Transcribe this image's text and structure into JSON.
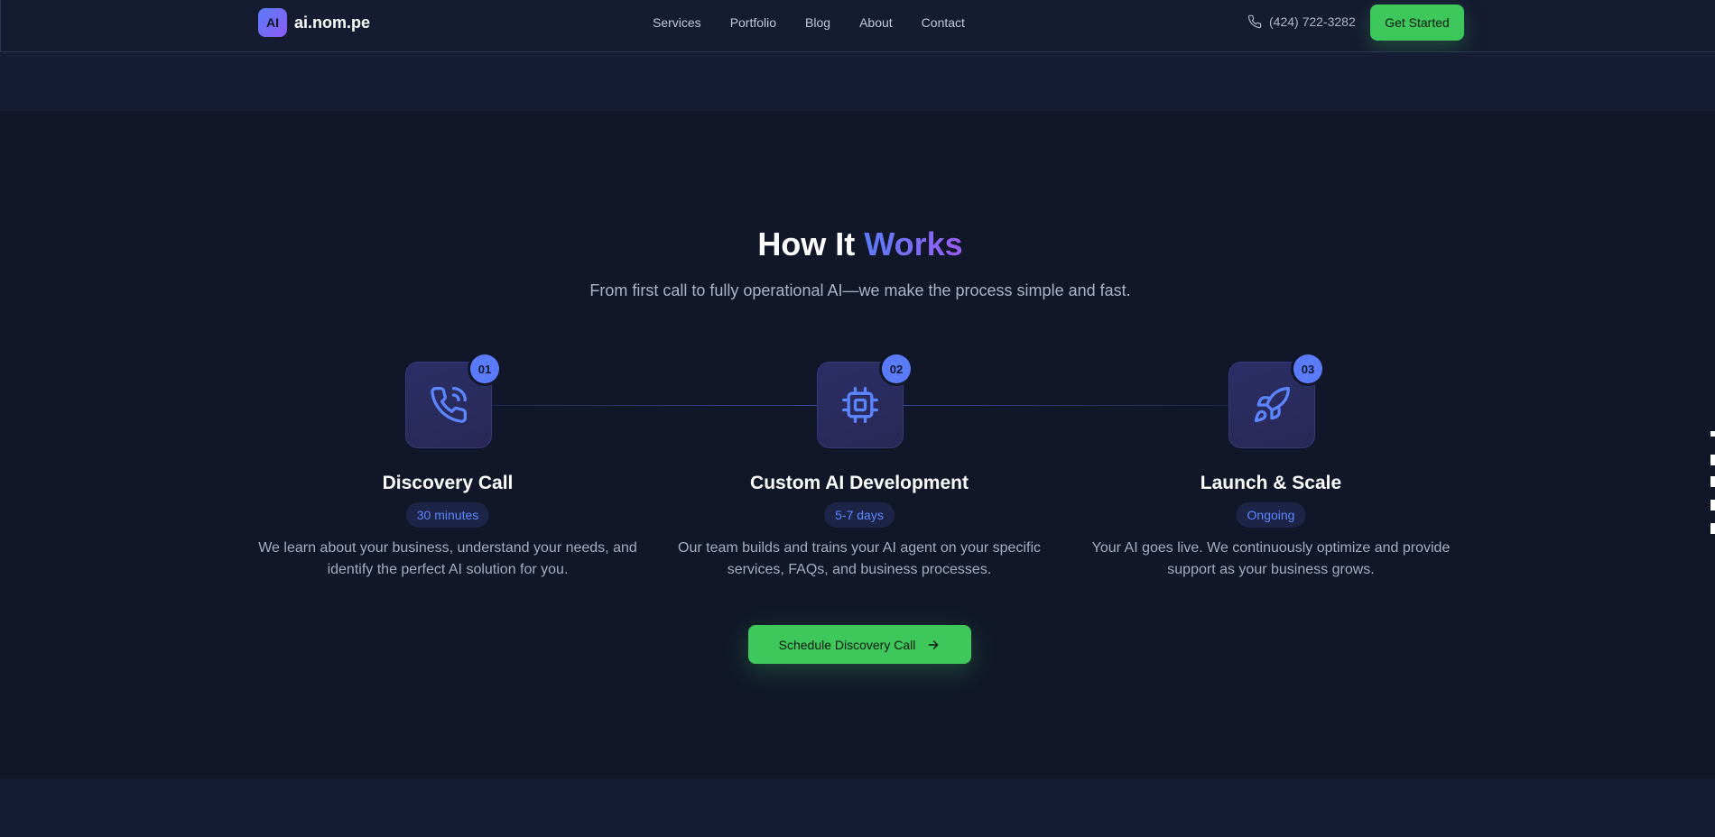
{
  "brand": {
    "mark": "AI",
    "name": "ai.nom.pe",
    "accent_color": "#5b7cfa",
    "cta_color": "#3ec75a"
  },
  "nav": {
    "items": [
      {
        "label": "Services"
      },
      {
        "label": "Portfolio"
      },
      {
        "label": "Blog"
      },
      {
        "label": "About"
      },
      {
        "label": "Contact"
      }
    ]
  },
  "header": {
    "phone_icon": "phone-icon",
    "phone": "(424) 722-3282",
    "cta_label": "Get Started"
  },
  "section": {
    "title_main": "How It",
    "title_accent": "Works",
    "subtitle": "From first call to fully operational AI—we make the process simple and fast.",
    "steps": [
      {
        "number": "01",
        "icon": "phone-call-icon",
        "title": "Discovery Call",
        "duration": "30 minutes",
        "description": "We learn about your business, understand your needs, and identify the perfect AI solution for you."
      },
      {
        "number": "02",
        "icon": "cpu-chip-icon",
        "title": "Custom AI Development",
        "duration": "5-7 days",
        "description": "Our team builds and trains your AI agent on your specific services, FAQs, and business processes."
      },
      {
        "number": "03",
        "icon": "rocket-icon",
        "title": "Launch & Scale",
        "duration": "Ongoing",
        "description": "Your AI goes live. We continuously optimize and provide support as your business grows."
      }
    ],
    "cta_label": "Schedule Discovery Call",
    "cta_icon": "arrow-right-icon"
  }
}
